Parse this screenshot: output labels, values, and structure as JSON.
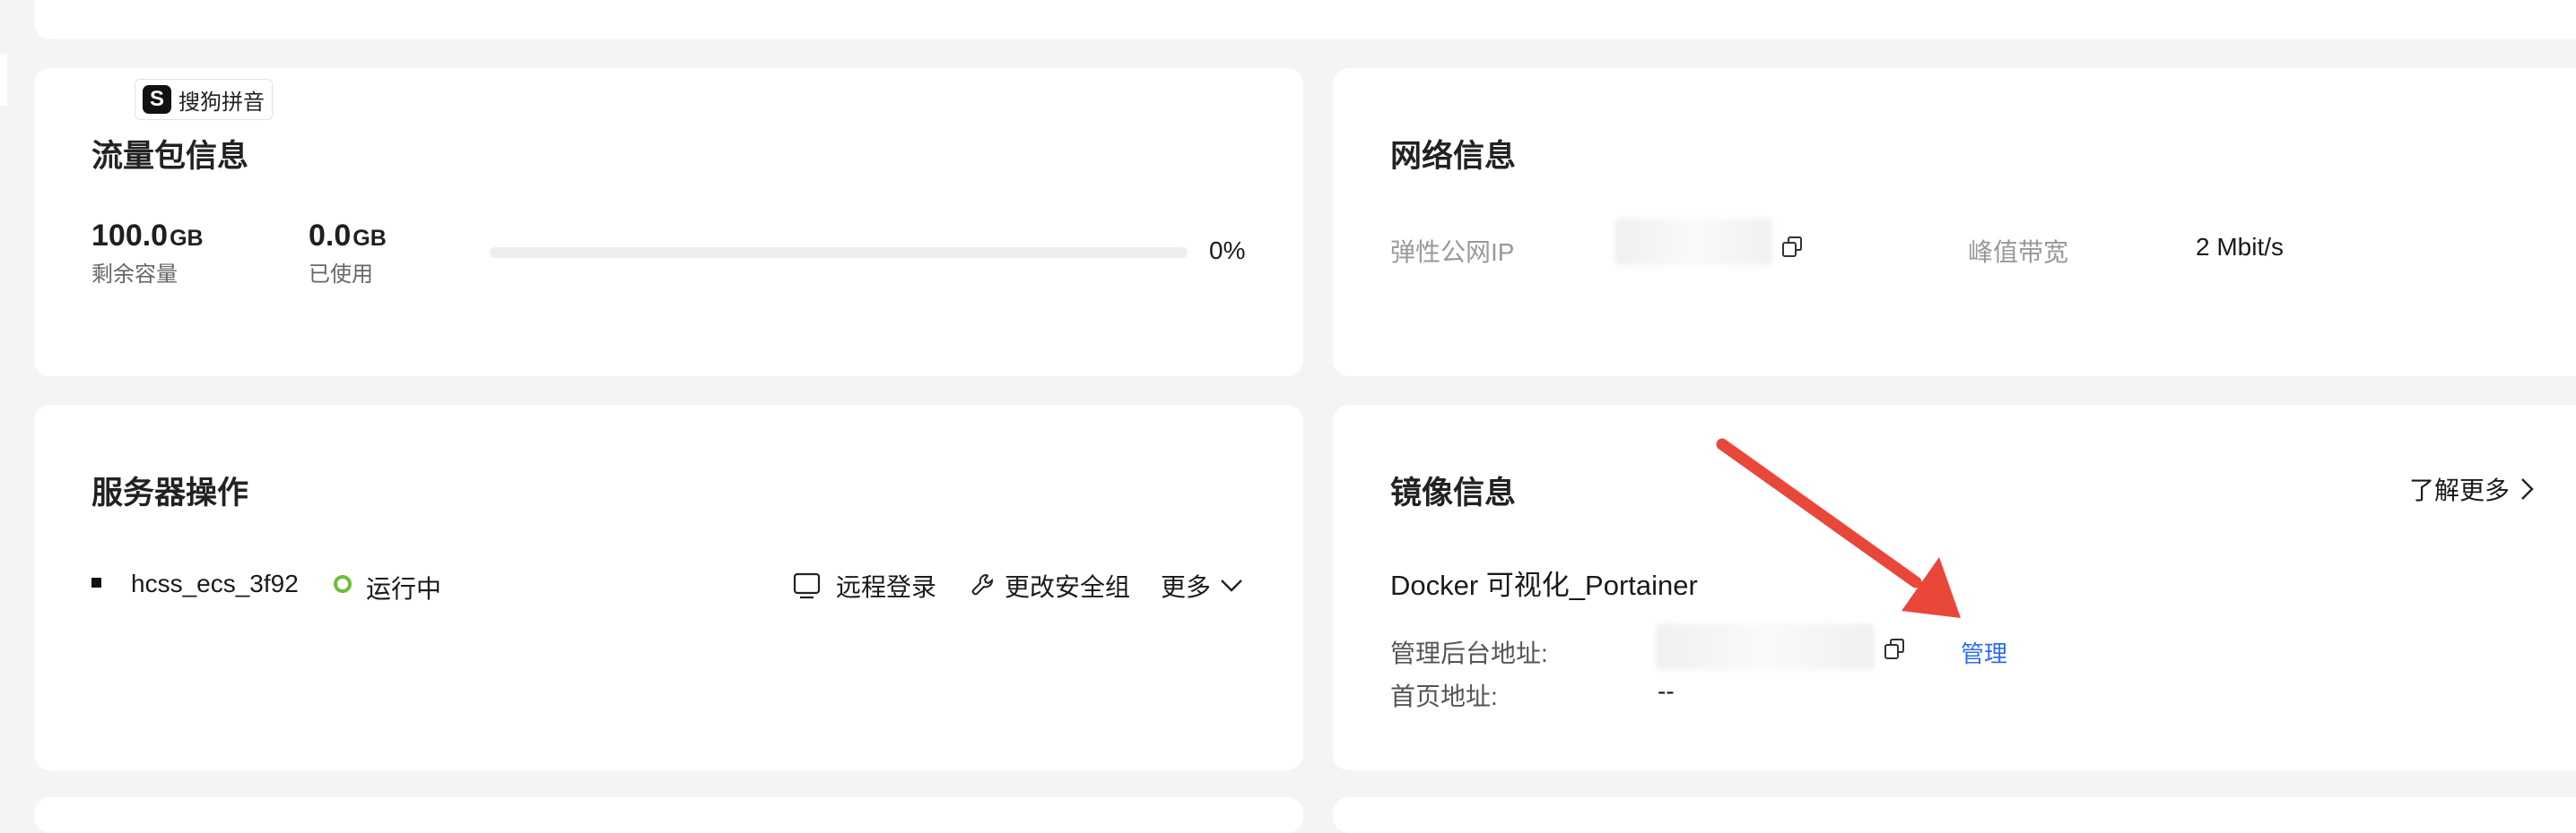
{
  "ime_badge": {
    "label": "搜狗拼音"
  },
  "traffic": {
    "title": "流量包信息",
    "remaining_value": "100.0",
    "remaining_unit": "GB",
    "remaining_label": "剩余容量",
    "used_value": "0.0",
    "used_unit": "GB",
    "used_label": "已使用",
    "usage_percent_text": "0%",
    "usage_percent": 0
  },
  "network": {
    "title": "网络信息",
    "ip_label": "弹性公网IP",
    "bandwidth_label": "峰值带宽",
    "bandwidth_value": "2 Mbit/s"
  },
  "server_ops": {
    "title": "服务器操作",
    "server_name": "hcss_ecs_3f92",
    "status": "运行中",
    "remote_login": "远程登录",
    "change_security_group": "更改安全组",
    "more": "更多"
  },
  "image_info": {
    "title": "镜像信息",
    "learn_more": "了解更多",
    "image_name": "Docker 可视化_Portainer",
    "admin_url_label": "管理后台地址:",
    "manage_link": "管理",
    "homepage_label": "首页地址:",
    "homepage_value": "--"
  },
  "colors": {
    "status_green": "#6dbe3b",
    "link_blue": "#2b6cf0",
    "arrow_red": "#e8473a",
    "background": "#f4f4f4"
  }
}
